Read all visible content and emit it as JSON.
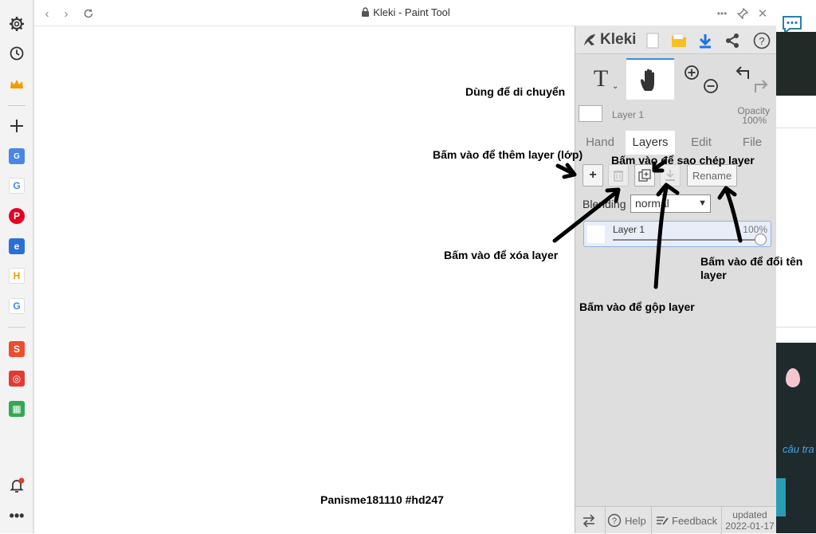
{
  "window": {
    "title": "Kleki - Paint Tool"
  },
  "kleki": {
    "logo_text": "Kleki",
    "tools": {
      "text_tool": "T"
    },
    "layer_preview": {
      "name": "Layer 1",
      "opacity_label": "Opacity",
      "opacity_value": "100%"
    },
    "tabs": [
      {
        "label": "Hand"
      },
      {
        "label": "Layers"
      },
      {
        "label": "Edit"
      },
      {
        "label": "File"
      }
    ],
    "layers_panel": {
      "rename_label": "Rename",
      "blending_label": "Blending",
      "blending_value": "normal",
      "layer": {
        "name": "Layer 1",
        "opacity": "100%"
      }
    },
    "footer": {
      "help": "Help",
      "feedback": "Feedback",
      "updated_label": "updated",
      "updated_date": "2022-01-17"
    }
  },
  "annotations": {
    "move": "Dùng để di chuyển",
    "add_layer": "Bấm vào để thêm layer (lớp)",
    "duplicate_layer": "Bấm vào để sao chép layer",
    "delete_layer": "Bấm vào để xóa layer",
    "merge_layer": "Bấm vào để gộp layer",
    "rename_layer_1": "Bấm vào để đổi tên",
    "rename_layer_2": "layer",
    "watermark": "Panisme181110 #hd247"
  },
  "right_strip": {
    "text": "câu tra"
  },
  "colors": {
    "accent": "#3b8de0",
    "download_icon": "#1a73e8",
    "folder_icon": "#f4b400"
  }
}
